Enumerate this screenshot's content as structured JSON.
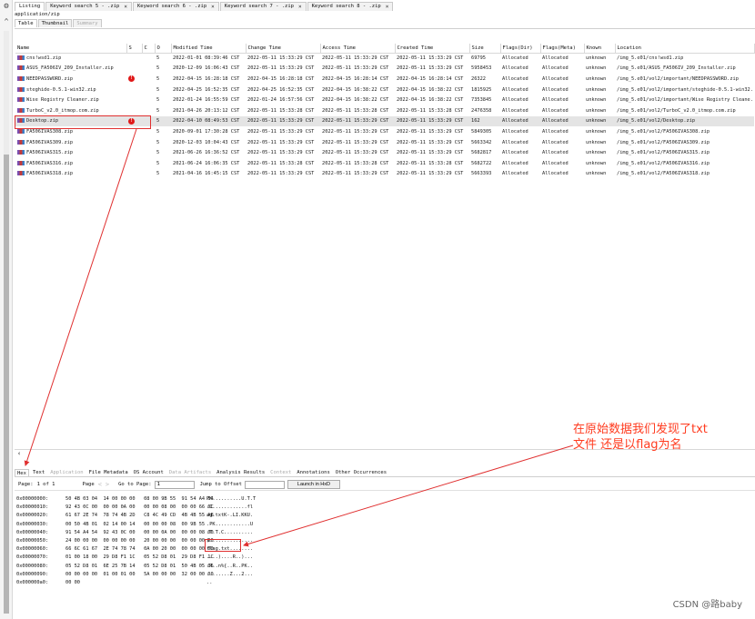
{
  "tabs": [
    {
      "label": "Listing",
      "active": true
    },
    {
      "label": "Keyword search 5 - .zip"
    },
    {
      "label": "Keyword search 6 - .zip"
    },
    {
      "label": "Keyword search 7 - .zip"
    },
    {
      "label": "Keyword search 8 - .zip"
    }
  ],
  "mime_label": "application/zip",
  "sub_tabs": [
    {
      "label": "Table",
      "active": true
    },
    {
      "label": "Thumbnail"
    },
    {
      "label": "Summary",
      "disabled": true
    }
  ],
  "columns": [
    "Name",
    "S",
    "C",
    "O",
    "Modified Time",
    "Change Time",
    "Access Time",
    "Created Time",
    "Size",
    "Flags(Dir)",
    "Flags(Meta)",
    "Known",
    "Location"
  ],
  "rows": [
    {
      "name": "cns!wsd1.zip",
      "s": "",
      "o": "5",
      "modified": "2022-01-01 08:39:46 CST",
      "change": "2022-05-11 15:33:29 CST",
      "access": "2022-05-11 15:33:29 CST",
      "created": "2022-05-11 15:33:29 CST",
      "size": "69795",
      "flags_dir": "Allocated",
      "flags_meta": "Allocated",
      "known": "unknown",
      "location": "/img_5.e01/cns!wsd1.zip"
    },
    {
      "name": "ASUS_FA506IV_209_Installer.zip",
      "s": "",
      "o": "5",
      "modified": "2020-12-09 16:06:43 CST",
      "change": "2022-05-11 15:33:29 CST",
      "access": "2022-05-11 15:33:29 CST",
      "created": "2022-05-11 15:33:29 CST",
      "size": "5958453",
      "flags_dir": "Allocated",
      "flags_meta": "Allocated",
      "known": "unknown",
      "location": "/img_5.e01/ASUS_FA506IV_209_Installer.zip"
    },
    {
      "name": "NEEDPASSWORD.zip",
      "s": "!",
      "o": "5",
      "modified": "2022-04-15 16:28:18 CST",
      "change": "2022-04-15 16:28:18 CST",
      "access": "2022-04-15 16:28:14 CST",
      "created": "2022-04-15 16:28:14 CST",
      "size": "26322",
      "flags_dir": "Allocated",
      "flags_meta": "Allocated",
      "known": "unknown",
      "location": "/img_5.e01/vol2/important/NEEDPASSWORD.zip"
    },
    {
      "name": "steghide-0.5.1-win32.zip",
      "s": "",
      "o": "5",
      "modified": "2022-04-25 16:52:35 CST",
      "change": "2022-04-25 16:52:35 CST",
      "access": "2022-04-15 16:38:22 CST",
      "created": "2022-04-15 16:38:22 CST",
      "size": "1815925",
      "flags_dir": "Allocated",
      "flags_meta": "Allocated",
      "known": "unknown",
      "location": "/img_5.e01/vol2/important/steghide-0.5.1-win32..."
    },
    {
      "name": "Wise Registry Cleaner.zip",
      "s": "",
      "o": "5",
      "modified": "2022-01-24 16:55:59 CST",
      "change": "2022-01-24 16:57:56 CST",
      "access": "2022-04-15 16:38:22 CST",
      "created": "2022-04-15 16:38:22 CST",
      "size": "7353845",
      "flags_dir": "Allocated",
      "flags_meta": "Allocated",
      "known": "unknown",
      "location": "/img_5.e01/vol2/important/Wise Registry Cleane..."
    },
    {
      "name": "TurboC_v2.0_itmop.com.zip",
      "s": "",
      "o": "5",
      "modified": "2021-04-26 20:13:12 CST",
      "change": "2022-05-11 15:33:28 CST",
      "access": "2022-05-11 15:33:28 CST",
      "created": "2022-05-11 15:33:28 CST",
      "size": "2476358",
      "flags_dir": "Allocated",
      "flags_meta": "Allocated",
      "known": "unknown",
      "location": "/img_5.e01/vol2/TurboC_v2.0_itmop.com.zip"
    },
    {
      "name": "Desktop.zip",
      "s": "!",
      "o": "5",
      "modified": "2022-04-10 08:49:53 CST",
      "change": "2022-05-11 15:33:29 CST",
      "access": "2022-05-11 15:33:29 CST",
      "created": "2022-05-11 15:33:29 CST",
      "size": "162",
      "flags_dir": "Allocated",
      "flags_meta": "Allocated",
      "known": "unknown",
      "location": "/img_5.e01/vol2/Desktop.zip",
      "selected": true
    },
    {
      "name": "FA506IVAS308.zip",
      "s": "",
      "o": "5",
      "modified": "2020-09-01 17:30:28 CST",
      "change": "2022-05-11 15:33:29 CST",
      "access": "2022-05-11 15:33:29 CST",
      "created": "2022-05-11 15:33:29 CST",
      "size": "5849305",
      "flags_dir": "Allocated",
      "flags_meta": "Allocated",
      "known": "unknown",
      "location": "/img_5.e01/vol2/FA506IVAS308.zip"
    },
    {
      "name": "FA506IVAS309.zip",
      "s": "",
      "o": "5",
      "modified": "2020-12-03 10:04:43 CST",
      "change": "2022-05-11 15:33:29 CST",
      "access": "2022-05-11 15:33:29 CST",
      "created": "2022-05-11 15:33:29 CST",
      "size": "5663342",
      "flags_dir": "Allocated",
      "flags_meta": "Allocated",
      "known": "unknown",
      "location": "/img_5.e01/vol2/FA506IVAS309.zip"
    },
    {
      "name": "FA506IVAS315.zip",
      "s": "",
      "o": "5",
      "modified": "2021-06-26 16:36:52 CST",
      "change": "2022-05-11 15:33:29 CST",
      "access": "2022-05-11 15:33:29 CST",
      "created": "2022-05-11 15:33:29 CST",
      "size": "5682817",
      "flags_dir": "Allocated",
      "flags_meta": "Allocated",
      "known": "unknown",
      "location": "/img_5.e01/vol2/FA506IVAS315.zip"
    },
    {
      "name": "FA506IVAS316.zip",
      "s": "",
      "o": "5",
      "modified": "2021-06-24 16:06:35 CST",
      "change": "2022-05-11 15:33:28 CST",
      "access": "2022-05-11 15:33:28 CST",
      "created": "2022-05-11 15:33:28 CST",
      "size": "5682722",
      "flags_dir": "Allocated",
      "flags_meta": "Allocated",
      "known": "unknown",
      "location": "/img_5.e01/vol2/FA506IVAS316.zip"
    },
    {
      "name": "FA506IVAS318.zip",
      "s": "",
      "o": "5",
      "modified": "2021-04-16 16:45:15 CST",
      "change": "2022-05-11 15:33:29 CST",
      "access": "2022-05-11 15:33:29 CST",
      "created": "2022-05-11 15:33:29 CST",
      "size": "5663393",
      "flags_dir": "Allocated",
      "flags_meta": "Allocated",
      "known": "unknown",
      "location": "/img_5.e01/vol2/FA506IVAS318.zip"
    }
  ],
  "bottom_tabs": [
    {
      "label": "Hex",
      "active": true
    },
    {
      "label": "Text"
    },
    {
      "label": "Application",
      "disabled": true
    },
    {
      "label": "File Metadata"
    },
    {
      "label": "OS Account"
    },
    {
      "label": "Data Artifacts",
      "disabled": true
    },
    {
      "label": "Analysis Results"
    },
    {
      "label": "Context",
      "disabled": true
    },
    {
      "label": "Annotations"
    },
    {
      "label": "Other Occurrences"
    }
  ],
  "pager": {
    "page_label": "Page:",
    "page_value": "1 of 1",
    "page_nav_label": "Page",
    "goto_label": "Go to Page:",
    "goto_value": "1",
    "jump_label": "Jump to Offset",
    "jump_value": "",
    "launch_label": "Launch in HxD"
  },
  "hex_rows": [
    {
      "offset": "0x00000000:",
      "bytes": "50 4B 03 04  14 00 00 00   08 00 9B 55  91 54 A4 54",
      "ascii": "PK..........U.T.T"
    },
    {
      "offset": "0x00000010:",
      "bytes": "92 43 0C 00  00 00 0A 00   00 00 08 00  00 00 66 6C",
      "ascii": ".C............fl"
    },
    {
      "offset": "0x00000020:",
      "bytes": "61 67 2E 74  78 74 4B 2D   C8 4C 49 CD  4B 4B 55 AB",
      "ascii": "ag.txtK-.LI.KKU."
    },
    {
      "offset": "0x00000030:",
      "bytes": "00 50 4B 01  02 14 00 14   00 00 00 08  00 9B 55",
      "ascii": ".PK............U"
    },
    {
      "offset": "0x00000040:",
      "bytes": "91 54 A4 54  92 43 0C 00   00 00 0A 00  00 00 08 00",
      "ascii": ".T.T.C.........."
    },
    {
      "offset": "0x00000050:",
      "bytes": "24 00 00 00  00 00 00 00   20 00 00 00  00 00 00 00",
      "ascii": "$..............."
    },
    {
      "offset": "0x00000060:",
      "bytes": "66 6C 61 67  2E 74 78 74   0A 00 20 00  00 00 00 00",
      "ascii": "flag.txt........"
    },
    {
      "offset": "0x00000070:",
      "bytes": "01 00 18 00  29 D8 F1 1C   05 52 D8 01  29 D8 F1 1C",
      "ascii": "....)....R..)..."
    },
    {
      "offset": "0x00000080:",
      "bytes": "05 52 D8 01  6E 25 7B 14   05 52 D8 01  50 4B 05 06",
      "ascii": ".R..n%{..R..PK.."
    },
    {
      "offset": "0x00000090:",
      "bytes": "00 00 00 00  01 00 01 00   5A 00 00 00  32 00 00 00",
      "ascii": "........Z...2..."
    },
    {
      "offset": "0x000000a0:",
      "bytes": "00 00",
      "ascii": ".."
    }
  ],
  "annotation": {
    "line1": "在原始数据我们发现了txt",
    "line2": "文件 还是以flag为名"
  },
  "watermark": "CSDN @路baby",
  "colors": {
    "annotation": "#ff3b1f",
    "highlight_box": "#e03030",
    "flag_icon": "#e01818"
  },
  "icons": {
    "settings": "gear-icon",
    "collapse": "chevron-up-icon",
    "file": "zip-file-icon",
    "notable": "exclamation-icon"
  }
}
